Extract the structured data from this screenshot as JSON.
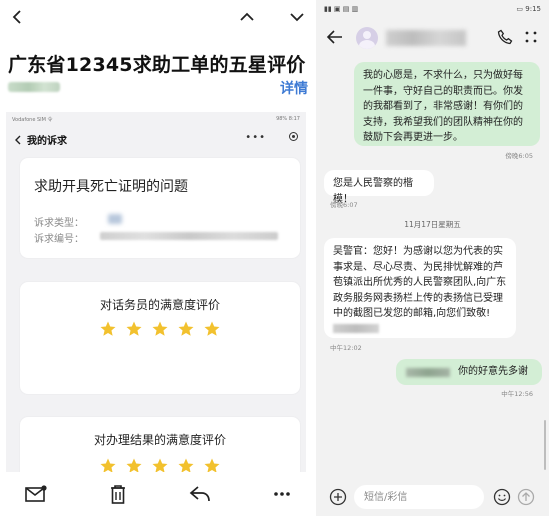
{
  "left": {
    "email": {
      "subject": "广东省12345求助工单的五星评价",
      "details_label": "详情"
    },
    "embedded_app": {
      "title": "我的诉求",
      "status_left": "Vodafone SIM 令",
      "status_right": "98% 8:17",
      "request": {
        "title": "求助开具死亡证明的问题",
        "type_label": "诉求类型：",
        "number_label": "诉求编号："
      },
      "rating_operator": {
        "title": "对话务员的满意度评价",
        "stars": 5
      },
      "rating_result": {
        "title": "对办理结果的满意度评价",
        "stars": 5
      }
    },
    "toolbar": [
      "mark-unread-icon",
      "delete-icon",
      "reply-icon",
      "more-icon"
    ]
  },
  "right": {
    "status_time": "9:15",
    "messages": [
      {
        "direction": "out",
        "text": "我的心愿是，不求什么，只为做好每一件事，守好自己的职责而已。你发的我都看到了，非常感谢！有你们的支持，我希望我们的团队精神在你的鼓励下会再更进一步。",
        "time": "傍晚6:05"
      },
      {
        "direction": "in",
        "text": "您是人民警察的楷模！",
        "time": "傍晚6:07"
      },
      {
        "direction": "in",
        "text_before_blur": "吴警官：您好！为感谢以您为代表的实事求是、尽心尽责、为民排忧解难的芦苞镇派出所优秀的人民警察团队,向广东政务服务网表扬栏上传的表扬信已受理中的截图已发您的邮箱,向您们致敬!",
        "time": "中午12:02"
      },
      {
        "direction": "out",
        "text": "你的好意先多谢",
        "time": "中午12:56"
      }
    ],
    "date_separator": "11月17日星期五",
    "composer": {
      "placeholder": "短信/彩信"
    }
  },
  "colors": {
    "outgoing_bubble": "#d3eed5",
    "incoming_bubble": "#ffffff",
    "star": "#f2c12e",
    "link_blue": "#3f7bd4"
  }
}
